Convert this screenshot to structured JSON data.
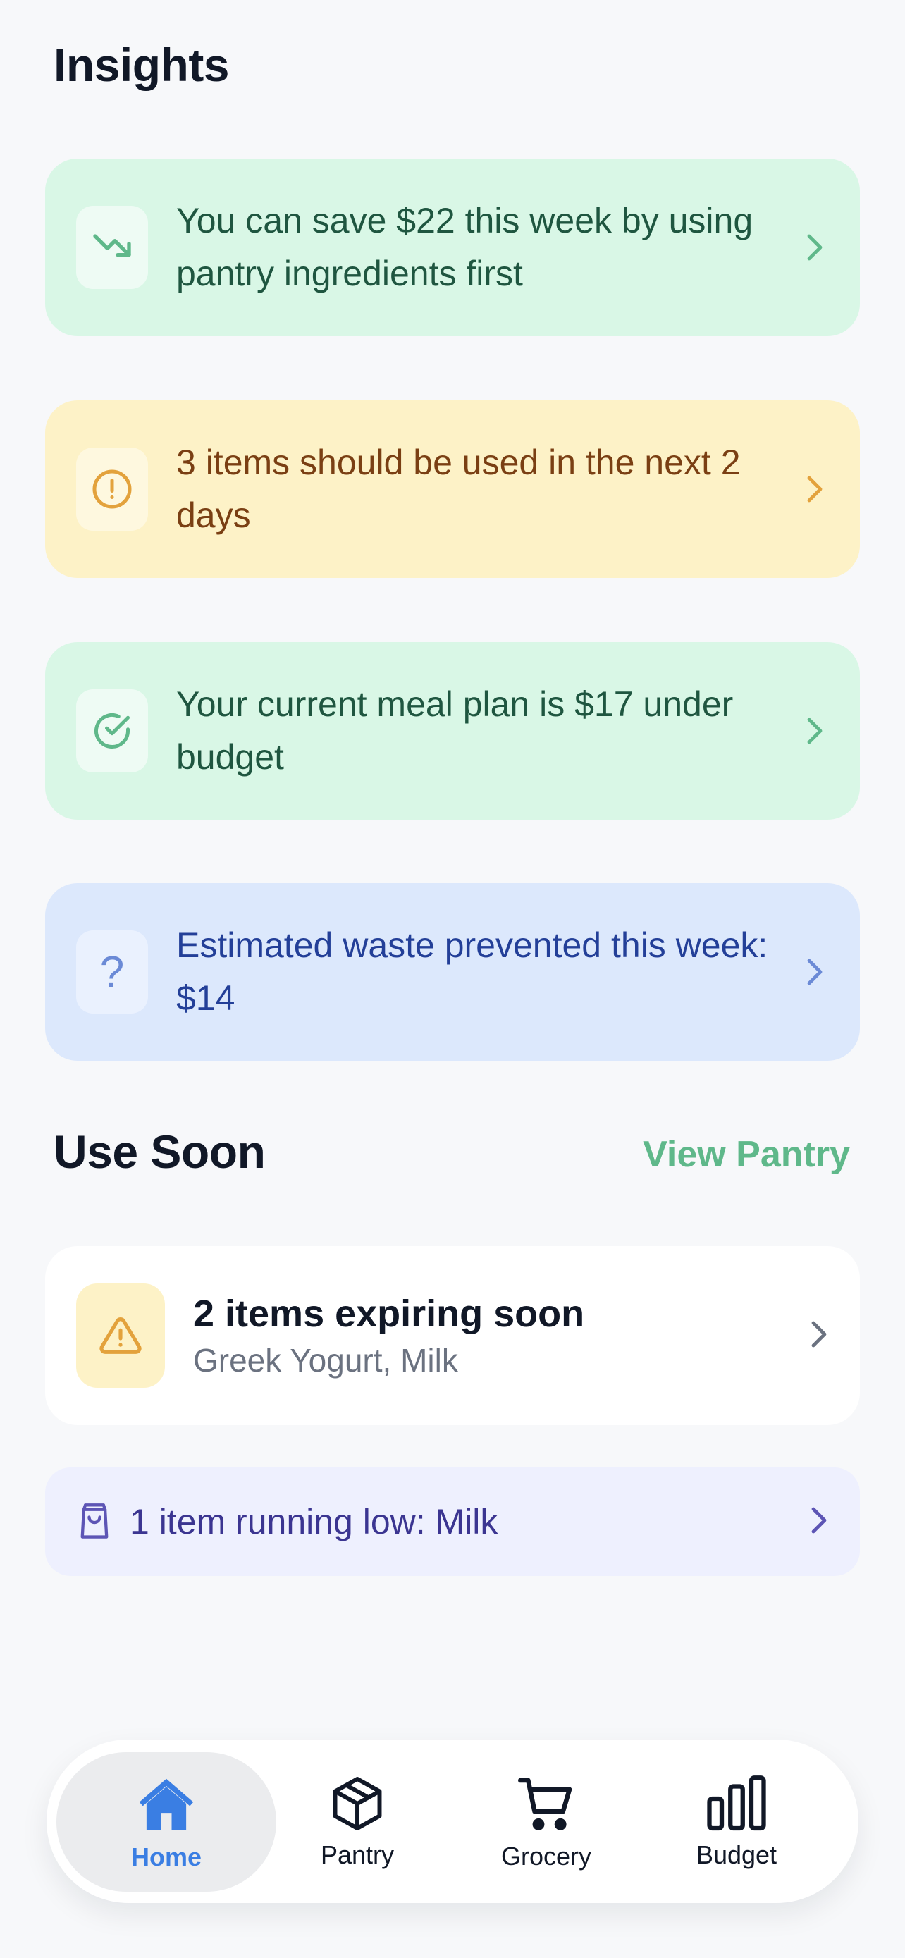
{
  "insights": {
    "title": "Insights",
    "cards": [
      {
        "text": "You can save $22 this week by using pantry ingredients first",
        "icon": "trending-down-icon",
        "tone": "green"
      },
      {
        "text": "3 items should be used in the next 2 days",
        "icon": "alert-circle-icon",
        "tone": "amber"
      },
      {
        "text": "Your current meal plan is $17 under budget",
        "icon": "check-circle-icon",
        "tone": "green"
      },
      {
        "text": "Estimated waste prevented this week: $14",
        "icon": "question-icon",
        "tone": "blue"
      }
    ]
  },
  "use_soon": {
    "title": "Use Soon",
    "link_label": "View Pantry",
    "expiring": {
      "title": "2 items expiring soon",
      "subtitle": "Greek Yogurt, Milk",
      "icon": "warning-triangle-icon"
    },
    "low_stock": {
      "text": "1 item running low: Milk",
      "icon": "shopping-bag-icon"
    }
  },
  "nav": {
    "items": [
      {
        "label": "Home",
        "icon": "home-icon",
        "active": true
      },
      {
        "label": "Pantry",
        "icon": "box-icon",
        "active": false
      },
      {
        "label": "Grocery",
        "icon": "cart-icon",
        "active": false
      },
      {
        "label": "Budget",
        "icon": "bar-chart-icon",
        "active": false
      }
    ]
  },
  "colors": {
    "green_bg": "#d9f7e6",
    "amber_bg": "#fdf2c7",
    "blue_bg": "#dce8fc",
    "accent_green": "#5fb88a",
    "accent_blue": "#3a7ee3"
  }
}
